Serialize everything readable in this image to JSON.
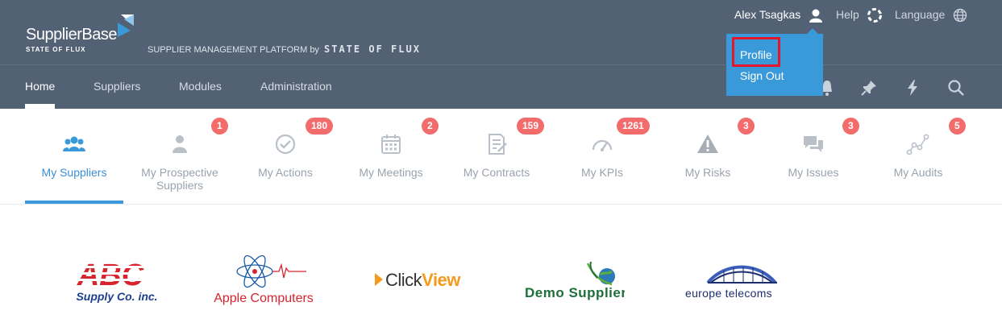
{
  "brand": {
    "name": "SupplierBase",
    "subtitle": "STATE OF FLUX",
    "tagline": "SUPPLIER MANAGEMENT PLATFORM",
    "tagline_by": "by",
    "tagline_brand": "STATE OF FLUX"
  },
  "header": {
    "user_name": "Alex Tsagkas",
    "help_label": "Help",
    "language_label": "Language"
  },
  "user_menu": {
    "items": [
      "Profile",
      "Sign Out"
    ],
    "highlighted": "Profile"
  },
  "nav": {
    "items": [
      "Home",
      "Suppliers",
      "Modules",
      "Administration"
    ],
    "active": "Home",
    "icons": [
      "bell-icon",
      "pin-icon",
      "lightning-icon",
      "search-icon"
    ]
  },
  "tiles": [
    {
      "label": "My Suppliers",
      "badge": "",
      "icon": "users-icon"
    },
    {
      "label": "My Prospective Suppliers",
      "badge": "1",
      "icon": "person-icon"
    },
    {
      "label": "My Actions",
      "badge": "180",
      "icon": "check-circle-icon"
    },
    {
      "label": "My Meetings",
      "badge": "2",
      "icon": "calendar-icon"
    },
    {
      "label": "My Contracts",
      "badge": "159",
      "icon": "contract-icon"
    },
    {
      "label": "My KPIs",
      "badge": "1261",
      "icon": "gauge-icon"
    },
    {
      "label": "My Risks",
      "badge": "3",
      "icon": "warning-icon"
    },
    {
      "label": "My Issues",
      "badge": "3",
      "icon": "chat-icon"
    },
    {
      "label": "My Audits",
      "badge": "5",
      "icon": "audit-icon"
    }
  ],
  "supplier_logos": [
    {
      "name": "ABC",
      "subtitle": "Supply Co. inc."
    },
    {
      "name": "Apple Computers"
    },
    {
      "name": "ClickView",
      "prefix": "Click",
      "suffix": "View"
    },
    {
      "name": "Demo Supplier"
    },
    {
      "name": "europe telecoms"
    }
  ],
  "colors": {
    "header_bg": "#526173",
    "accent": "#3a9ad9",
    "badge": "#f26c6c",
    "highlight_box": "#e5152c"
  }
}
